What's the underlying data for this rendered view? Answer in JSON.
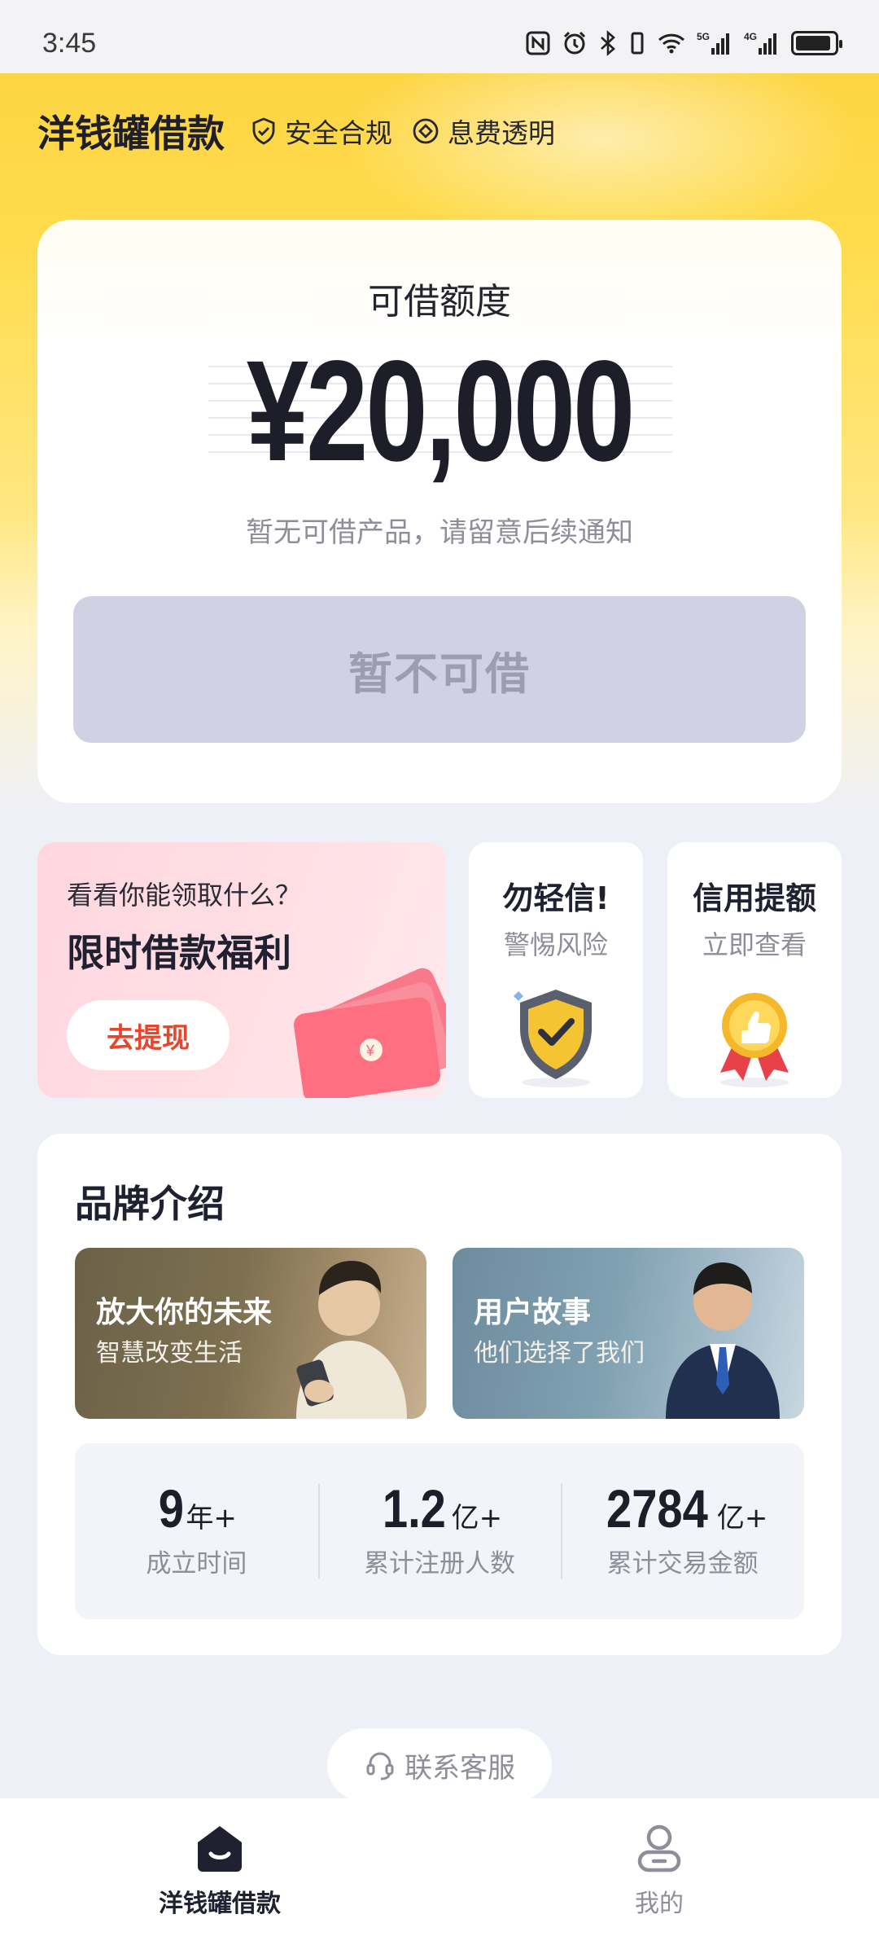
{
  "status_bar": {
    "time": "3:45",
    "icons": [
      "nfc-icon",
      "alarm-icon",
      "bluetooth-icon",
      "vibrate-icon",
      "wifi-icon",
      "signal-5g-icon",
      "signal-4g-icon",
      "battery-icon"
    ],
    "network_5g": "5G",
    "network_4g": "4G"
  },
  "header": {
    "app_name": "洋钱罐借款",
    "tags": [
      "安全合规",
      "息费透明"
    ]
  },
  "quota_card": {
    "label": "可借额度",
    "amount": "¥20,000",
    "notice": "暂无可借产品，请留意后续通知",
    "button_label": "暂不可借"
  },
  "promo": {
    "question": "看看你能领取什么？",
    "title": "限时借款福利",
    "button_label": "去提现"
  },
  "risk_card": {
    "title": "勿轻信!",
    "subtitle": "警惕风险"
  },
  "credit_card": {
    "title": "信用提额",
    "subtitle": "立即查看"
  },
  "brand_section": {
    "title": "品牌介绍",
    "tiles": [
      {
        "title": "放大你的未来",
        "subtitle": "智慧改变生活"
      },
      {
        "title": "用户故事",
        "subtitle": "他们选择了我们"
      }
    ],
    "stats": [
      {
        "value": "9",
        "unit": "年+",
        "label": "成立时间"
      },
      {
        "value": "1.2",
        "unit": "亿+",
        "label": "累计注册人数"
      },
      {
        "value": "2784",
        "unit": "亿+",
        "label": "累计交易金额"
      }
    ]
  },
  "service_button": {
    "label": "联系客服"
  },
  "bottom_nav": {
    "items": [
      {
        "label": "洋钱罐借款",
        "icon": "home-icon",
        "active": true
      },
      {
        "label": "我的",
        "icon": "profile-icon",
        "active": false
      }
    ]
  },
  "colors": {
    "brand_yellow": "#fcd23f",
    "promo_red": "#e8452c",
    "disabled_button": "#d1d1e4",
    "page_bg": "#eef0f7"
  }
}
